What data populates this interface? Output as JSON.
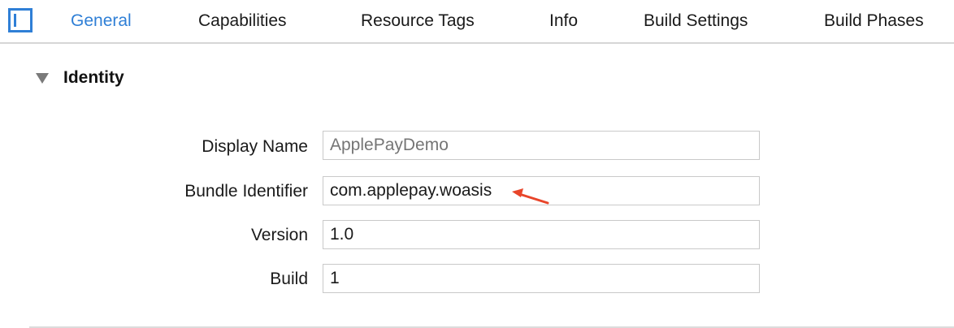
{
  "tabs": {
    "general": "General",
    "capabilities": "Capabilities",
    "resource_tags": "Resource Tags",
    "info": "Info",
    "build_settings": "Build Settings",
    "build_phases": "Build Phases",
    "active": "General"
  },
  "colors": {
    "accent": "#2f7fd6",
    "annotation_arrow": "#e8452a"
  },
  "identity": {
    "title": "Identity",
    "display_name_label": "Display Name",
    "display_name_placeholder": "ApplePayDemo",
    "bundle_identifier_label": "Bundle Identifier",
    "bundle_identifier_value": "com.applepay.woasis",
    "version_label": "Version",
    "version_value": "1.0",
    "build_label": "Build",
    "build_value": "1"
  }
}
